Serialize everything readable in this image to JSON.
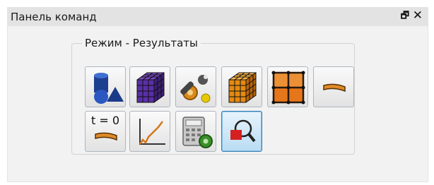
{
  "panel": {
    "title": "Панель команд",
    "float_icon": "🗗",
    "close_icon": "✕"
  },
  "group": {
    "legend": "Режим - Результаты"
  },
  "buttons": [
    {
      "name": "geometry-button",
      "icon": "geometry-shapes-icon"
    },
    {
      "name": "mesh-button",
      "icon": "purple-mesh-cube-icon"
    },
    {
      "name": "tools-button",
      "icon": "wrench-gear-icon"
    },
    {
      "name": "results-cube-button",
      "icon": "orange-mesh-cube-icon"
    },
    {
      "name": "grid-button",
      "icon": "orange-grid-icon"
    },
    {
      "name": "beam-button",
      "icon": "deformed-beam-icon"
    },
    {
      "name": "initial-state-button",
      "icon": "beam-t0-icon",
      "label": "t = 0"
    },
    {
      "name": "graph-button",
      "icon": "line-graph-icon"
    },
    {
      "name": "calculator-button",
      "icon": "calculator-gear-icon"
    },
    {
      "name": "zoom-button",
      "icon": "magnifier-icon",
      "active": true
    }
  ]
}
